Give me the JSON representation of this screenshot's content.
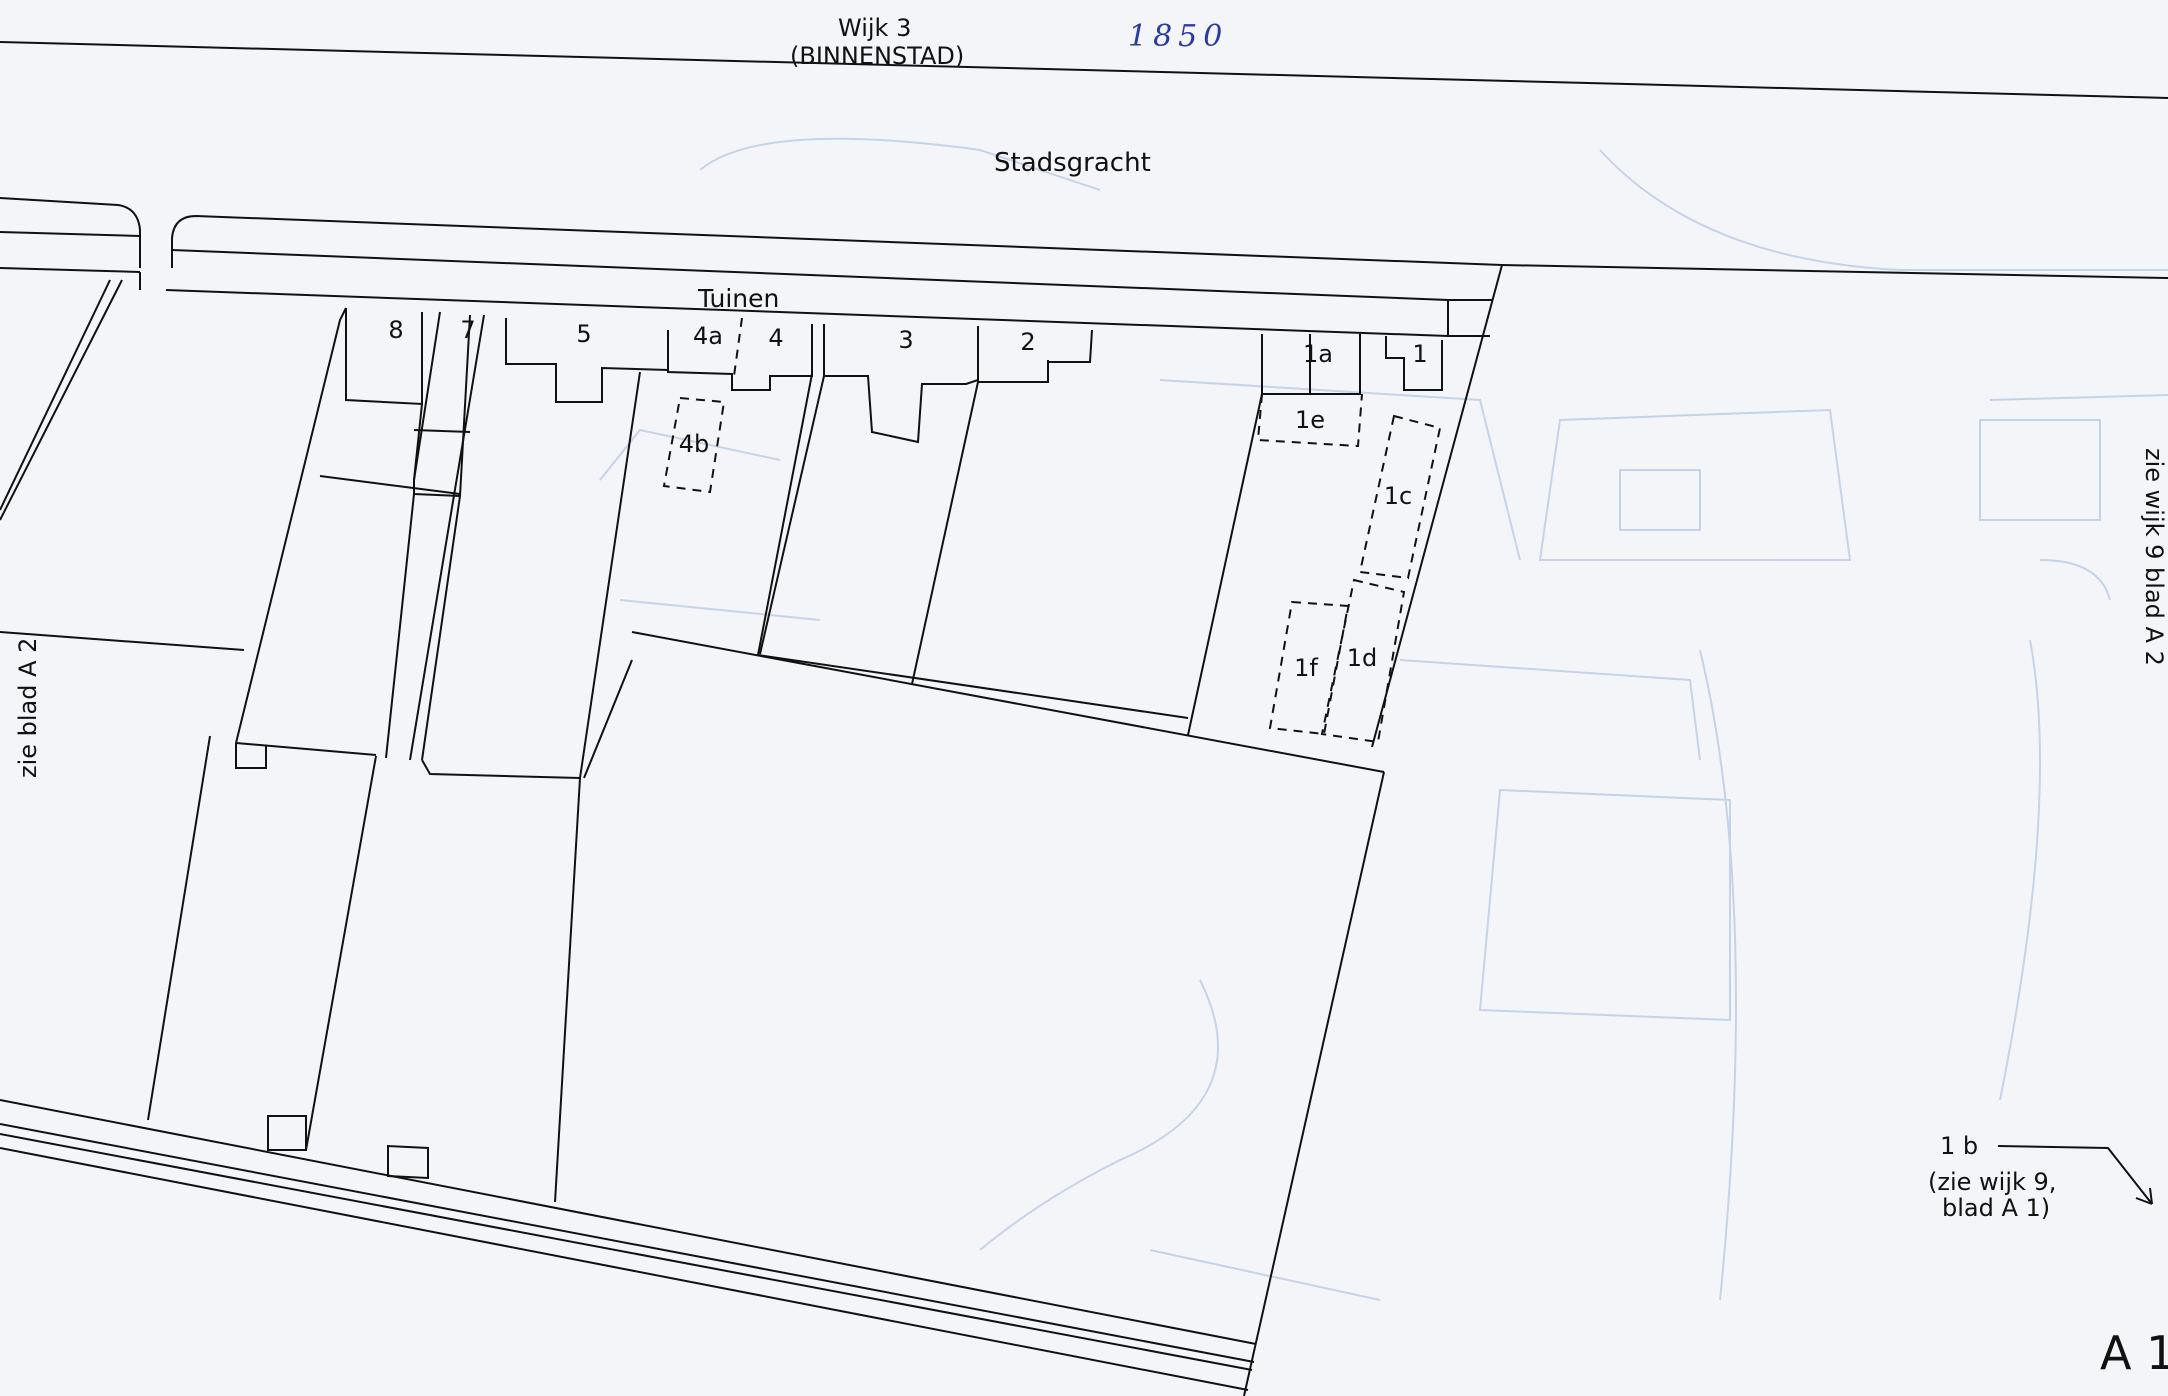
{
  "header": {
    "district": "Wijk 3",
    "area": "(BINNENSTAD)",
    "year_note": "1850"
  },
  "streets": {
    "canal": "Stadsgracht",
    "top_lane": "Tuinen"
  },
  "lots": [
    "8",
    "7",
    "5",
    "4a",
    "4",
    "3",
    "2",
    "1a",
    "1",
    "1e",
    "4b",
    "1c",
    "1f",
    "1d"
  ],
  "margin_refs": {
    "left": "zie blad A 2",
    "right": "zie wijk 9 blad A 2",
    "parcel_ref_label": "1 b",
    "parcel_ref_note_1": "(zie wijk 9,",
    "parcel_ref_note_2": "blad A 1)"
  },
  "sheet_id": "A 1",
  "colors": {
    "paper": "#f3f5f9",
    "ink": "#111111",
    "bleed": "#b9c9e3",
    "pen": "#2a3aa0"
  }
}
